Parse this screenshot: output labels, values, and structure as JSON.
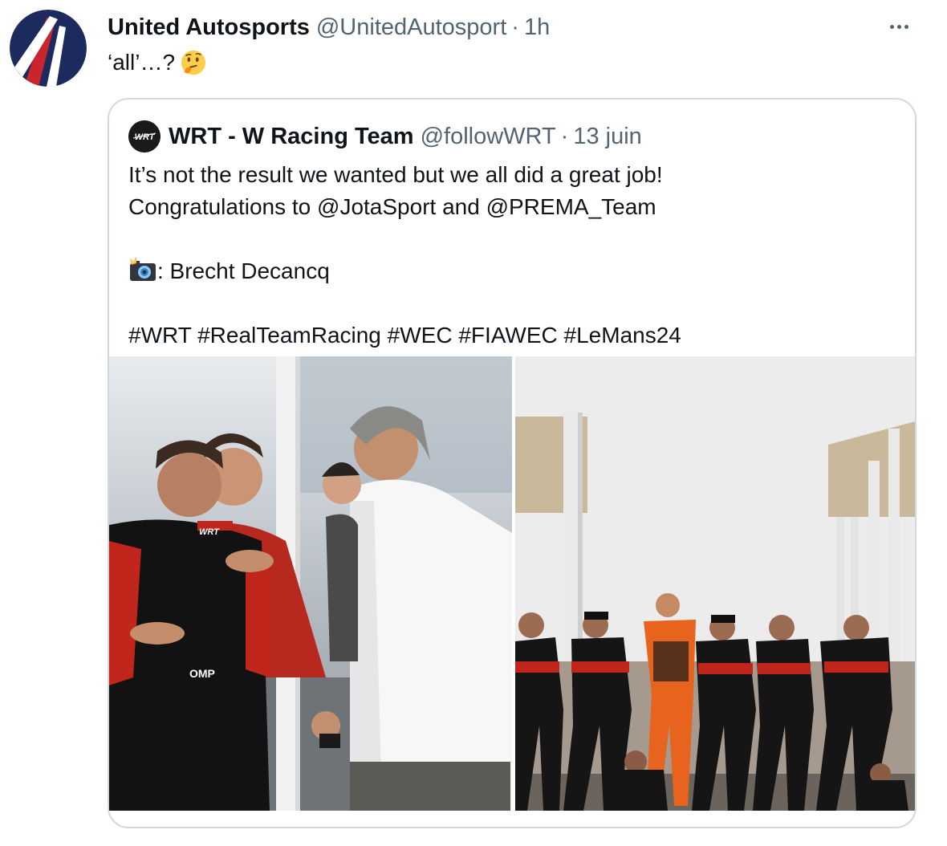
{
  "tweet": {
    "display_name": "United Autosports",
    "handle": "@UnitedAutosport",
    "separator": "·",
    "time": "1h",
    "text": "‘all’…?",
    "emoji": "thinking-face-emoji",
    "avatar_icon": "united-autosports-logo"
  },
  "quote": {
    "display_name": "WRT - W Racing Team",
    "handle": "@followWRT",
    "separator": "·",
    "time": "13 juin",
    "avatar_text": "WRT",
    "lines": [
      "It’s not the result we wanted but we all did a great job!",
      "Congratulations to @JotaSport and @PREMA_Team"
    ],
    "credit": ": Brecht Decancq",
    "credit_emoji": "camera-flash-emoji",
    "hashtags": "#WRT #RealTeamRacing #WEC #FIAWEC #LeMans24",
    "photos": [
      {
        "name": "drivers-hugging-photo",
        "visible_text": [
          "WRT",
          "OMP"
        ]
      },
      {
        "name": "crew-on-pit-wall-photo"
      }
    ]
  },
  "colors": {
    "text_primary": "#0f1419",
    "text_secondary": "#536471",
    "border": "#cfd9de",
    "logo_navy": "#1c2a5e",
    "logo_red": "#c8262c"
  }
}
